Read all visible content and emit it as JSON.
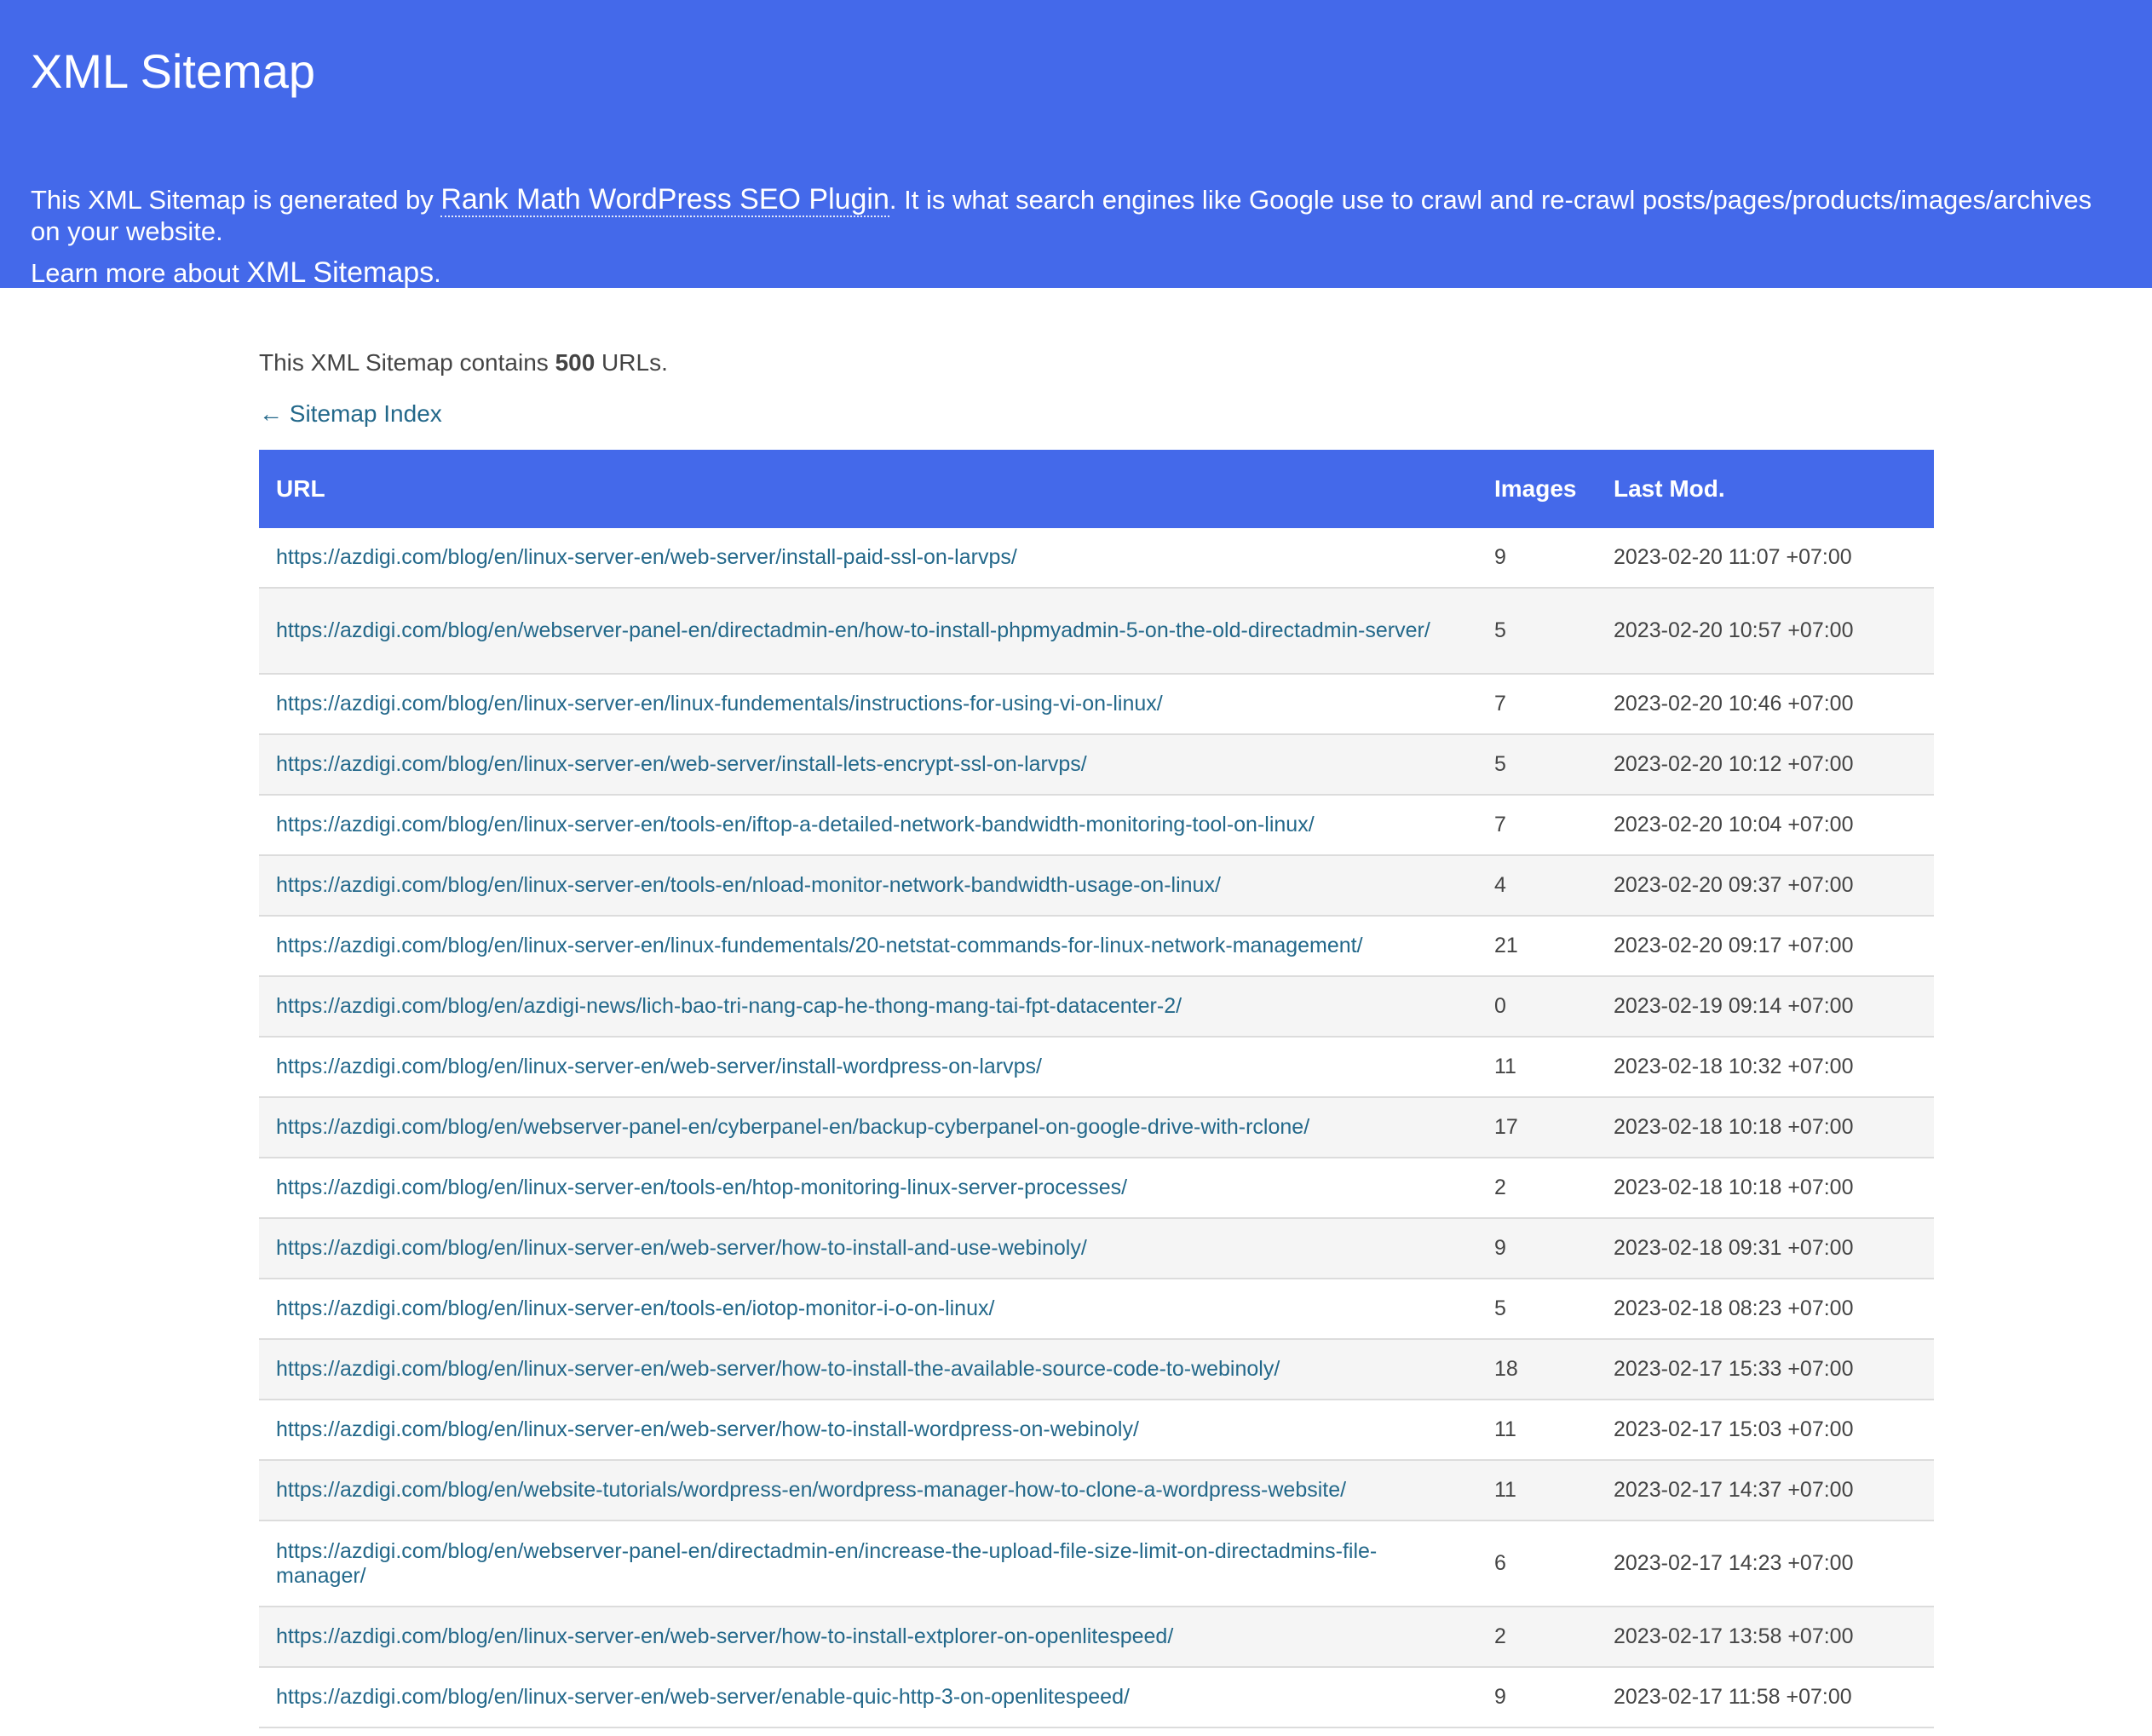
{
  "header": {
    "title": "XML Sitemap",
    "intro_prefix": "This XML Sitemap is generated by ",
    "intro_link": "Rank Math WordPress SEO Plugin",
    "intro_suffix": ". It is what search engines like Google use to crawl and re-crawl posts/pages/products/images/archives on your website.",
    "learn_prefix": "Learn more about ",
    "learn_link": "XML Sitemaps",
    "learn_suffix": "."
  },
  "summary": {
    "prefix": "This XML Sitemap contains ",
    "count": "500",
    "suffix": " URLs."
  },
  "back_link": "← Sitemap Index",
  "table": {
    "headers": [
      "URL",
      "Images",
      "Last Mod."
    ],
    "rows": [
      {
        "url": "https://azdigi.com/blog/en/linux-server-en/web-server/install-paid-ssl-on-larvps/",
        "images": "9",
        "lastmod": "2023-02-20 11:07 +07:00",
        "wrap": false
      },
      {
        "url": "https://azdigi.com/blog/en/webserver-panel-en/directadmin-en/how-to-install-phpmyadmin-5-on-the-old-directadmin-server/",
        "images": "5",
        "lastmod": "2023-02-20 10:57 +07:00",
        "wrap": true
      },
      {
        "url": "https://azdigi.com/blog/en/linux-server-en/linux-fundementals/instructions-for-using-vi-on-linux/",
        "images": "7",
        "lastmod": "2023-02-20 10:46 +07:00",
        "wrap": false
      },
      {
        "url": "https://azdigi.com/blog/en/linux-server-en/web-server/install-lets-encrypt-ssl-on-larvps/",
        "images": "5",
        "lastmod": "2023-02-20 10:12 +07:00",
        "wrap": false
      },
      {
        "url": "https://azdigi.com/blog/en/linux-server-en/tools-en/iftop-a-detailed-network-bandwidth-monitoring-tool-on-linux/",
        "images": "7",
        "lastmod": "2023-02-20 10:04 +07:00",
        "wrap": false
      },
      {
        "url": "https://azdigi.com/blog/en/linux-server-en/tools-en/nload-monitor-network-bandwidth-usage-on-linux/",
        "images": "4",
        "lastmod": "2023-02-20 09:37 +07:00",
        "wrap": false
      },
      {
        "url": "https://azdigi.com/blog/en/linux-server-en/linux-fundementals/20-netstat-commands-for-linux-network-management/",
        "images": "21",
        "lastmod": "2023-02-20 09:17 +07:00",
        "wrap": false
      },
      {
        "url": "https://azdigi.com/blog/en/azdigi-news/lich-bao-tri-nang-cap-he-thong-mang-tai-fpt-datacenter-2/",
        "images": "0",
        "lastmod": "2023-02-19 09:14 +07:00",
        "wrap": false
      },
      {
        "url": "https://azdigi.com/blog/en/linux-server-en/web-server/install-wordpress-on-larvps/",
        "images": "11",
        "lastmod": "2023-02-18 10:32 +07:00",
        "wrap": false
      },
      {
        "url": "https://azdigi.com/blog/en/webserver-panel-en/cyberpanel-en/backup-cyberpanel-on-google-drive-with-rclone/",
        "images": "17",
        "lastmod": "2023-02-18 10:18 +07:00",
        "wrap": false
      },
      {
        "url": "https://azdigi.com/blog/en/linux-server-en/tools-en/htop-monitoring-linux-server-processes/",
        "images": "2",
        "lastmod": "2023-02-18 10:18 +07:00",
        "wrap": false
      },
      {
        "url": "https://azdigi.com/blog/en/linux-server-en/web-server/how-to-install-and-use-webinoly/",
        "images": "9",
        "lastmod": "2023-02-18 09:31 +07:00",
        "wrap": false
      },
      {
        "url": "https://azdigi.com/blog/en/linux-server-en/tools-en/iotop-monitor-i-o-on-linux/",
        "images": "5",
        "lastmod": "2023-02-18 08:23 +07:00",
        "wrap": false
      },
      {
        "url": "https://azdigi.com/blog/en/linux-server-en/web-server/how-to-install-the-available-source-code-to-webinoly/",
        "images": "18",
        "lastmod": "2023-02-17 15:33 +07:00",
        "wrap": false
      },
      {
        "url": "https://azdigi.com/blog/en/linux-server-en/web-server/how-to-install-wordpress-on-webinoly/",
        "images": "11",
        "lastmod": "2023-02-17 15:03 +07:00",
        "wrap": false
      },
      {
        "url": "https://azdigi.com/blog/en/website-tutorials/wordpress-en/wordpress-manager-how-to-clone-a-wordpress-website/",
        "images": "11",
        "lastmod": "2023-02-17 14:37 +07:00",
        "wrap": false
      },
      {
        "url": "https://azdigi.com/blog/en/webserver-panel-en/directadmin-en/increase-the-upload-file-size-limit-on-directadmins-file-manager/",
        "images": "6",
        "lastmod": "2023-02-17 14:23 +07:00",
        "wrap": true
      },
      {
        "url": "https://azdigi.com/blog/en/linux-server-en/web-server/how-to-install-extplorer-on-openlitespeed/",
        "images": "2",
        "lastmod": "2023-02-17 13:58 +07:00",
        "wrap": false
      },
      {
        "url": "https://azdigi.com/blog/en/linux-server-en/web-server/enable-quic-http-3-on-openlitespeed/",
        "images": "9",
        "lastmod": "2023-02-17 11:58 +07:00",
        "wrap": false
      }
    ]
  },
  "colors": {
    "accent": "#4469ea",
    "link": "#23688a",
    "text": "#444444",
    "row_alt": "#f5f5f5"
  }
}
